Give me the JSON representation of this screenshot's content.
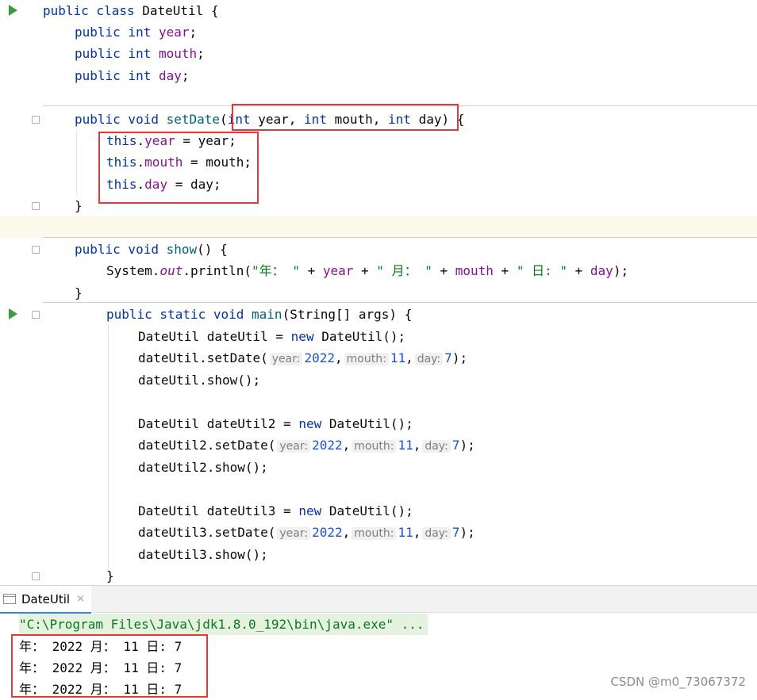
{
  "editor": {
    "class_line": {
      "kw": "public class",
      "name": "DateUtil",
      "brace": "{"
    },
    "fields": [
      {
        "kw": "public int",
        "name": "year"
      },
      {
        "kw": "public int",
        "name": "mouth"
      },
      {
        "kw": "public int",
        "name": "day"
      }
    ],
    "setdate_sig": {
      "kw": "public void",
      "name": "setDate",
      "open": "(",
      "p1t": "int",
      "p1n": "year,",
      "p2t": "int",
      "p2n": "mouth,",
      "p3t": "int",
      "p3n": "day",
      "close": ") {"
    },
    "assigns": [
      {
        "kw": "this",
        "field": "year",
        "rhs": " = year;"
      },
      {
        "kw": "this",
        "field": "mouth",
        "rhs": " = mouth;"
      },
      {
        "kw": "this",
        "field": "day",
        "rhs": " = day;"
      }
    ],
    "close_brace": "}",
    "show_sig": {
      "kw": "public void",
      "name": "show",
      "rest": "() {"
    },
    "println": {
      "pre": "System.",
      "out": "out",
      "mid": ".println(",
      "s1": "\"年： \"",
      "op1": " + ",
      "f1": "year",
      "op2": " + ",
      "s2": "\" 月： \"",
      "op3": " + ",
      "f2": "mouth",
      "op4": " + ",
      "s3": "\" 日: \"",
      "op5": " + ",
      "f3": "day",
      "end": ");"
    },
    "main_sig": {
      "kw": "public static void",
      "name": "main",
      "rest": "(String[] args) {"
    },
    "blocks": [
      {
        "decl_type": "DateUtil",
        "decl_var": "dateUtil",
        "eq": " = ",
        "new_kw": "new",
        "ctor": " DateUtil();",
        "call": "dateUtil.setDate(",
        "h1": "year:",
        "v1": "2022",
        "h2": "mouth:",
        "v2": "11",
        "h3": "day:",
        "v3": "7",
        "call_end": ");",
        "show": "dateUtil.show();"
      },
      {
        "decl_type": "DateUtil",
        "decl_var": "dateUtil2",
        "eq": " = ",
        "new_kw": "new",
        "ctor": " DateUtil();",
        "call": "dateUtil2.setDate(",
        "h1": "year:",
        "v1": "2022",
        "h2": "mouth:",
        "v2": "11",
        "h3": "day:",
        "v3": "7",
        "call_end": ");",
        "show": "dateUtil2.show();"
      },
      {
        "decl_type": "DateUtil",
        "decl_var": "dateUtil3",
        "eq": " = ",
        "new_kw": "new",
        "ctor": " DateUtil();",
        "call": "dateUtil3.setDate(",
        "h1": "year:",
        "v1": "2022",
        "h2": "mouth:",
        "v2": "11",
        "h3": "day:",
        "v3": "7",
        "call_end": ");",
        "show": "dateUtil3.show();"
      }
    ]
  },
  "run_panel": {
    "tab_label": "DateUtil",
    "tab_close": "×",
    "command": "\"C:\\Program Files\\Java\\jdk1.8.0_192\\bin\\java.exe\" ...",
    "output": [
      "年： 2022 月： 11 日: 7",
      "年： 2022 月： 11 日: 7",
      "年： 2022 月： 11 日: 7"
    ]
  },
  "watermark": "CSDN @m0_73067372",
  "colors": {
    "keyword": "#0033b3",
    "field": "#871094",
    "number": "#1750eb",
    "string": "#067d17",
    "annotation_box": "#e53935",
    "run_icon": "#3d9c3a"
  }
}
